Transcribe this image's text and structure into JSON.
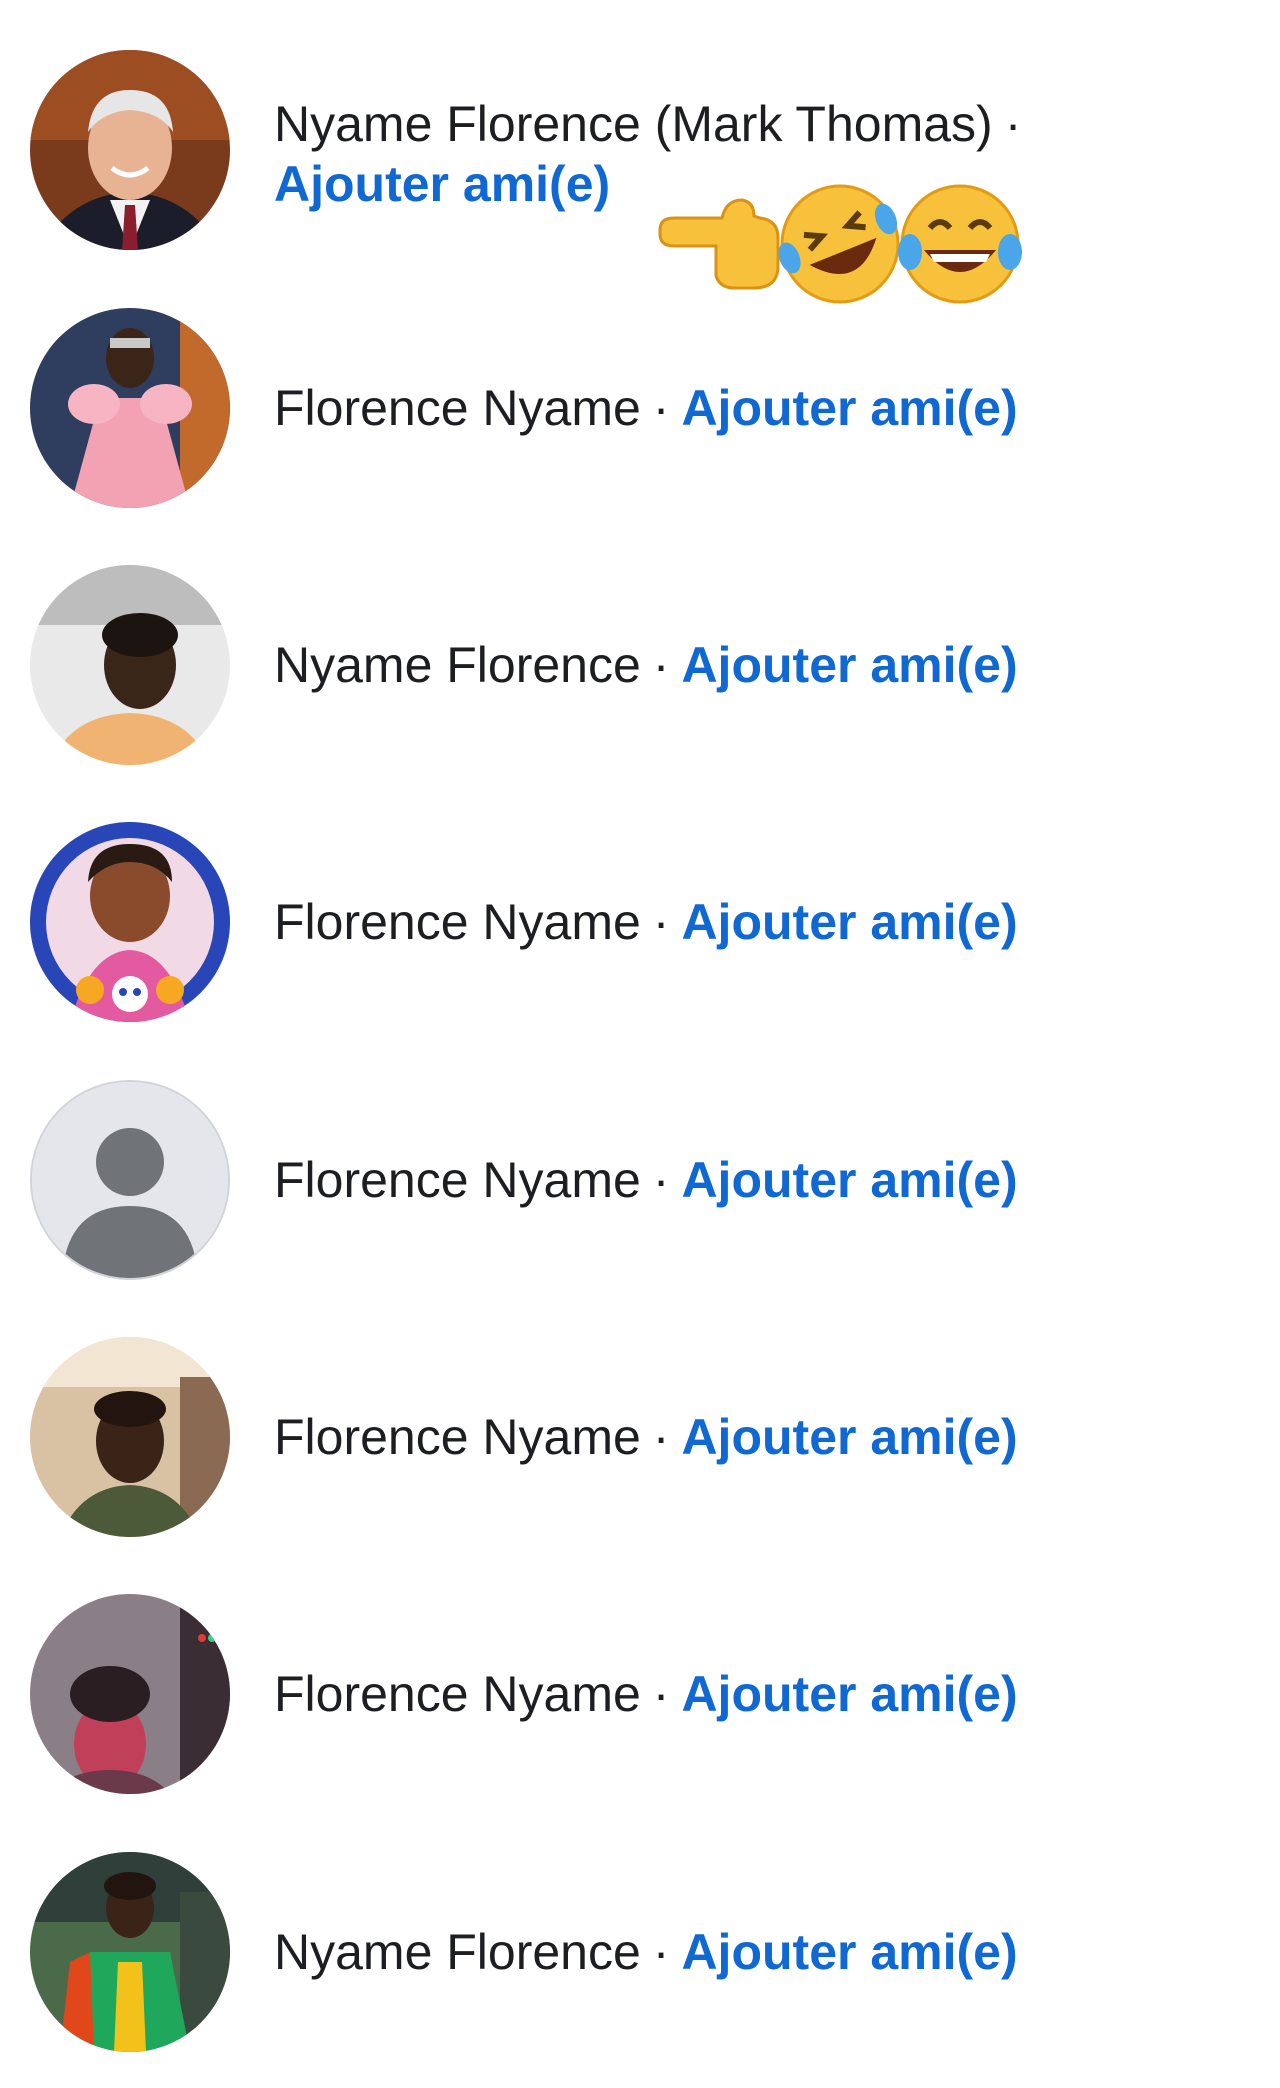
{
  "colors": {
    "name_text": "#1c1e21",
    "add_friend_link": "#1068d2",
    "background": "#ffffff"
  },
  "first_result": {
    "name": "Nyame Florence (Mark Thomas)",
    "separator": "·",
    "add_label": "Ajouter ami(e)",
    "emojis": [
      "backhand-index-pointing-left",
      "rolling-on-the-floor-laughing",
      "face-with-tears-of-joy"
    ]
  },
  "results": [
    {
      "name": "Florence Nyame",
      "separator": "·",
      "add_label": "Ajouter ami(e)",
      "avatar": "photo-pink-dress"
    },
    {
      "name": "Nyame Florence",
      "separator": "·",
      "add_label": "Ajouter ami(e)",
      "avatar": "photo-orange-top"
    },
    {
      "name": "Florence Nyame",
      "separator": "·",
      "add_label": "Ajouter ami(e)",
      "avatar": "photo-framed-blue"
    },
    {
      "name": "Florence Nyame",
      "separator": "·",
      "add_label": "Ajouter ami(e)",
      "avatar": "default-silhouette"
    },
    {
      "name": "Florence Nyame",
      "separator": "·",
      "add_label": "Ajouter ami(e)",
      "avatar": "photo-indoor-selfie"
    },
    {
      "name": "Florence Nyame",
      "separator": "·",
      "add_label": "Ajouter ami(e)",
      "avatar": "photo-head-wrap"
    },
    {
      "name": "Nyame Florence",
      "separator": "·",
      "add_label": "Ajouter ami(e)",
      "avatar": "photo-green-jacket"
    }
  ]
}
